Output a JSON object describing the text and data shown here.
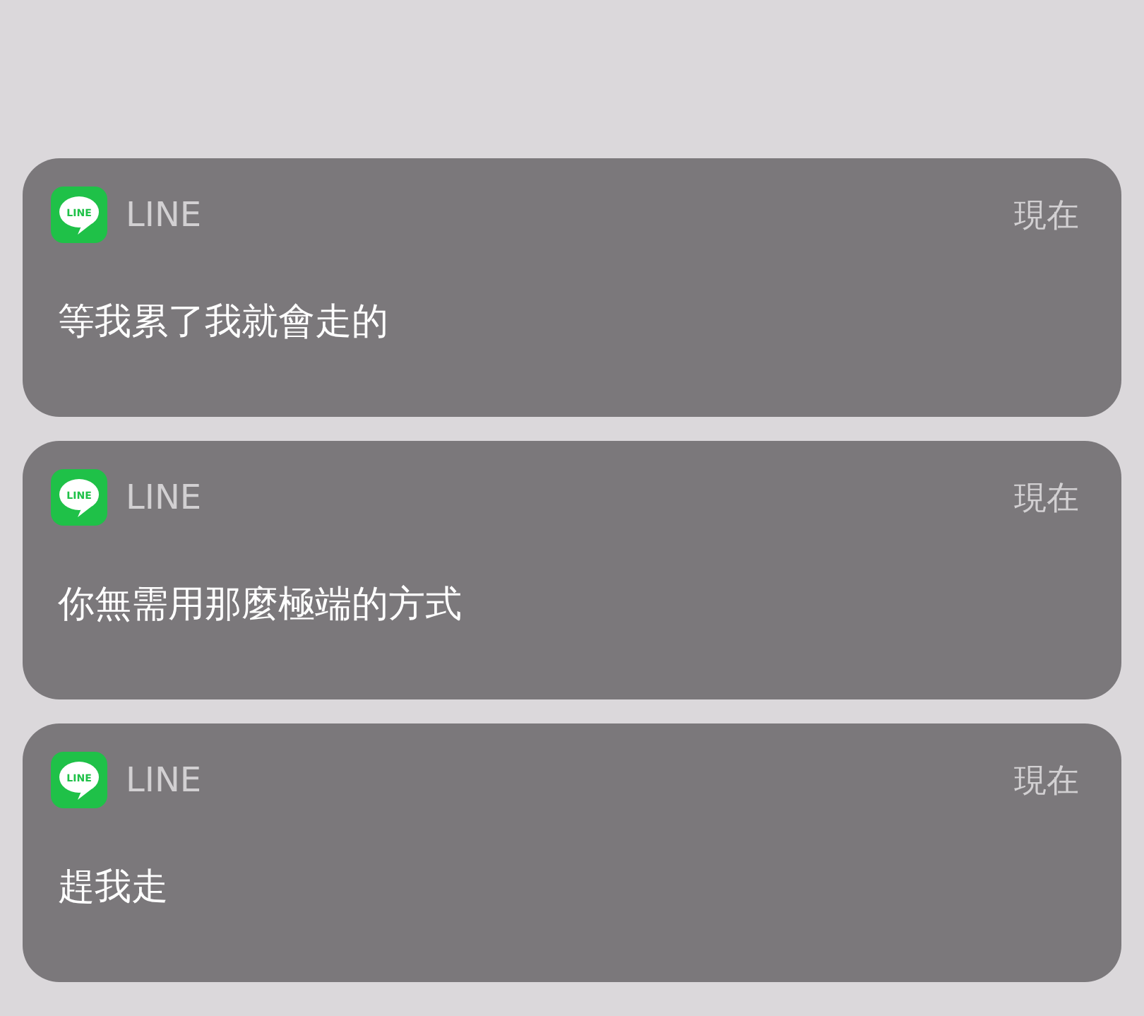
{
  "notifications": [
    {
      "app": "LINE",
      "icon_label": "LINE",
      "time": "現在",
      "message": "等我累了我就會走的"
    },
    {
      "app": "LINE",
      "icon_label": "LINE",
      "time": "現在",
      "message": "你無需用那麼極端的方式"
    },
    {
      "app": "LINE",
      "icon_label": "LINE",
      "time": "現在",
      "message": "趕我走"
    }
  ]
}
